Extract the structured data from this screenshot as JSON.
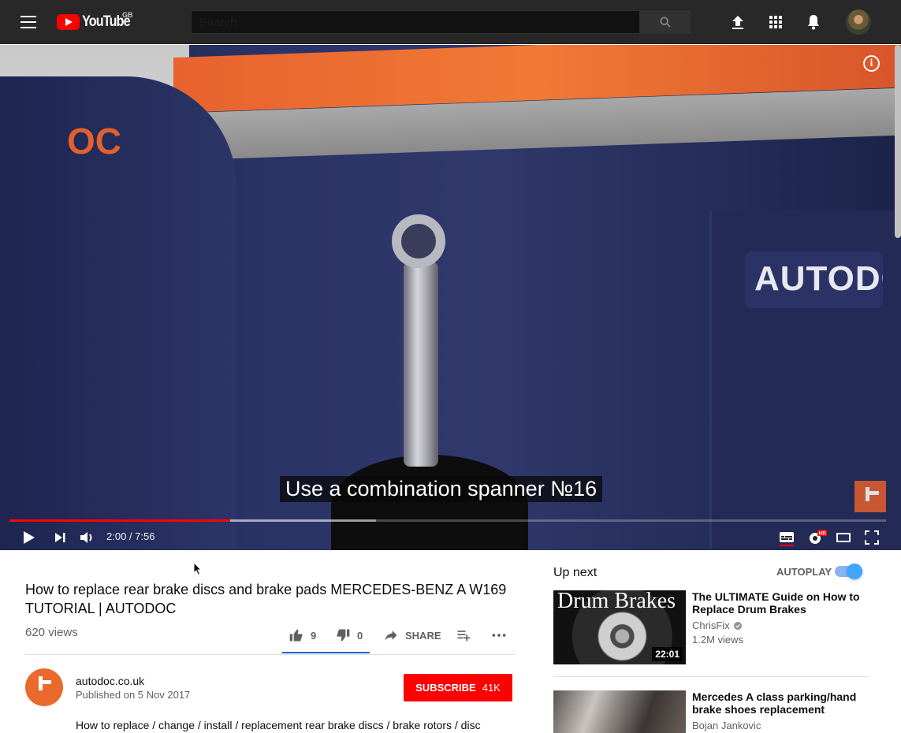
{
  "header": {
    "logo_text": "YouTube",
    "country_code": "GB",
    "search_placeholder": "Search",
    "icons": [
      "menu-icon",
      "upload-icon",
      "apps-icon",
      "notifications-icon",
      "search-icon"
    ]
  },
  "player": {
    "caption": "Use a combination spanner №16",
    "current_time": "2:00",
    "duration": "7:56",
    "time_display": "2:00 / 7:56",
    "played_fraction": 0.252,
    "buffered_fraction": 0.418,
    "quality_badge": "HD",
    "patch_text": "AUTODC",
    "sleeve_text": "OC"
  },
  "video": {
    "title": "How to replace rear brake discs and brake pads MERCEDES-BENZ A W169 TUTORIAL | AUTODOC",
    "views": "620 views",
    "likes": "9",
    "dislikes": "0",
    "share_label": "SHARE",
    "like_ratio": 1.0
  },
  "channel": {
    "name": "autodoc.co.uk",
    "published": "Published on 5 Nov 2017",
    "subscribe_label": "SUBSCRIBE",
    "subscriber_count": "41K",
    "description": "How to replace / change / install / replacement rear brake discs / brake rotors / disc"
  },
  "sidebar": {
    "up_next_label": "Up next",
    "autoplay_label": "AUTOPLAY",
    "autoplay_on": true,
    "videos": [
      {
        "thumb_title": "Drum Brakes",
        "title": "The ULTIMATE Guide on How to Replace Drum Brakes",
        "channel": "ChrisFix",
        "verified": true,
        "views": "1.2M views",
        "duration": "22:01"
      },
      {
        "title": "Mercedes A class parking/hand brake shoes replacement",
        "channel": "Bojan Jankovic"
      }
    ]
  },
  "colors": {
    "brand_red": "#ff0000",
    "accent_blue": "#065fd4",
    "masthead": "#282828"
  }
}
